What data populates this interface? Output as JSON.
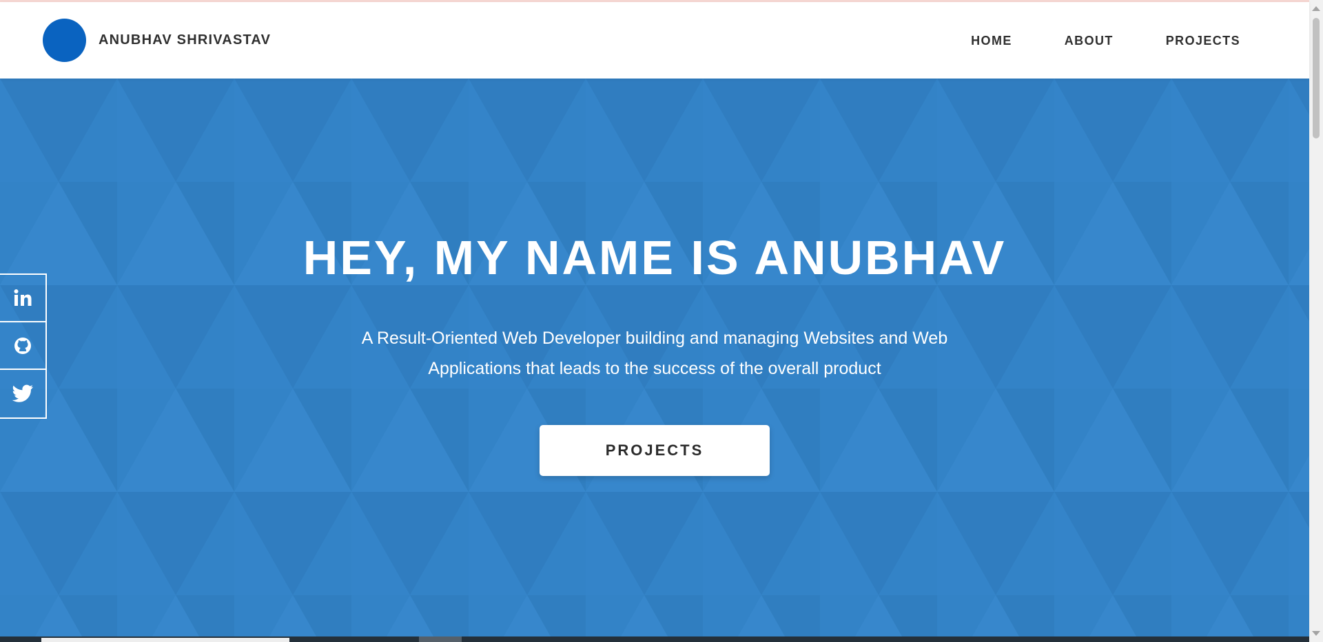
{
  "header": {
    "brand_name": "ANUBHAV SHRIVASTAV",
    "nav": [
      {
        "label": "HOME"
      },
      {
        "label": "ABOUT"
      },
      {
        "label": "PROJECTS"
      }
    ]
  },
  "hero": {
    "title": "HEY, MY NAME IS ANUBHAV",
    "subtitle": "A Result-Oriented Web Developer building and managing Websites and Web Applications that leads to the success of the overall product",
    "cta_label": "PROJECTS"
  },
  "social": [
    {
      "icon": "linkedin-icon"
    },
    {
      "icon": "github-icon"
    },
    {
      "icon": "twitter-icon"
    }
  ],
  "colors": {
    "hero_background": "#3383c7",
    "logo": "#0a63c0",
    "nav_text": "#2f2f2f",
    "button_background": "#ffffff"
  }
}
